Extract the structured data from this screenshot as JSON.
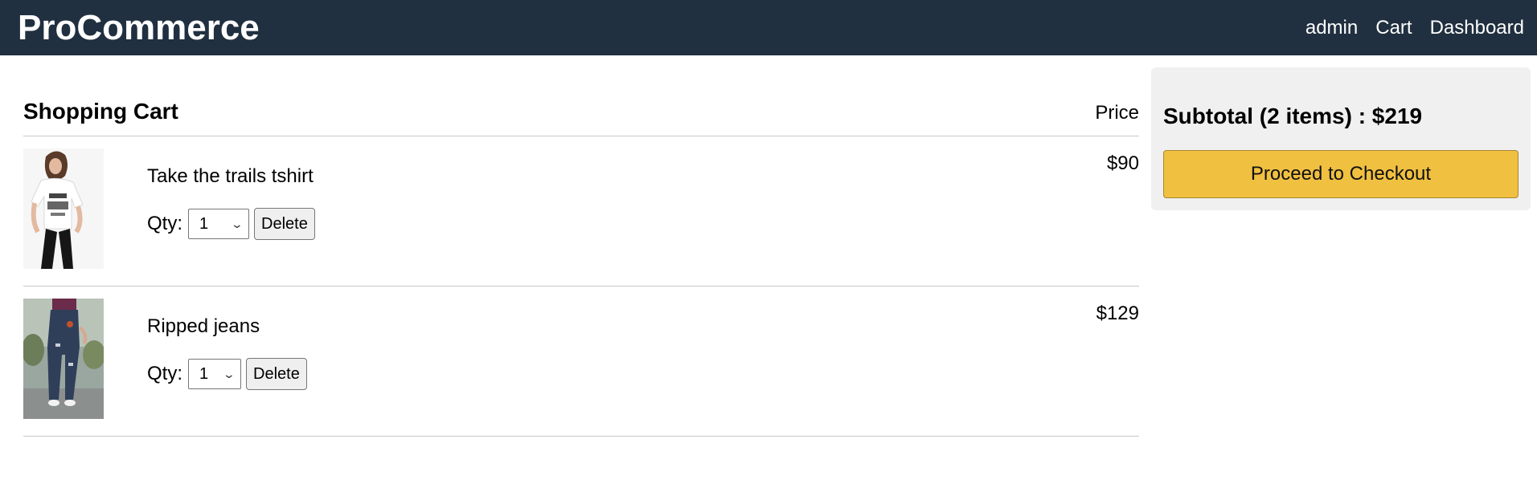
{
  "navbar": {
    "brand": "ProCommerce",
    "links": [
      "admin",
      "Cart",
      "Dashboard"
    ]
  },
  "cart": {
    "title": "Shopping Cart",
    "price_heading": "Price",
    "qty_label": "Qty:",
    "delete_label": "Delete",
    "items": [
      {
        "name": "Take the trails tshirt",
        "price": "$90",
        "qty": "1",
        "image_icon": "woman-in-white-tshirt-photo"
      },
      {
        "name": "Ripped jeans",
        "price": "$129",
        "qty": "1",
        "image_icon": "woman-in-ripped-jeans-photo"
      }
    ]
  },
  "summary": {
    "subtotal": "Subtotal (2 items) : $219",
    "checkout_label": "Proceed to Checkout"
  },
  "colors": {
    "navbar_bg": "#203040",
    "checkout_btn": "#f0c040",
    "summary_bg": "#f0f0f0"
  }
}
